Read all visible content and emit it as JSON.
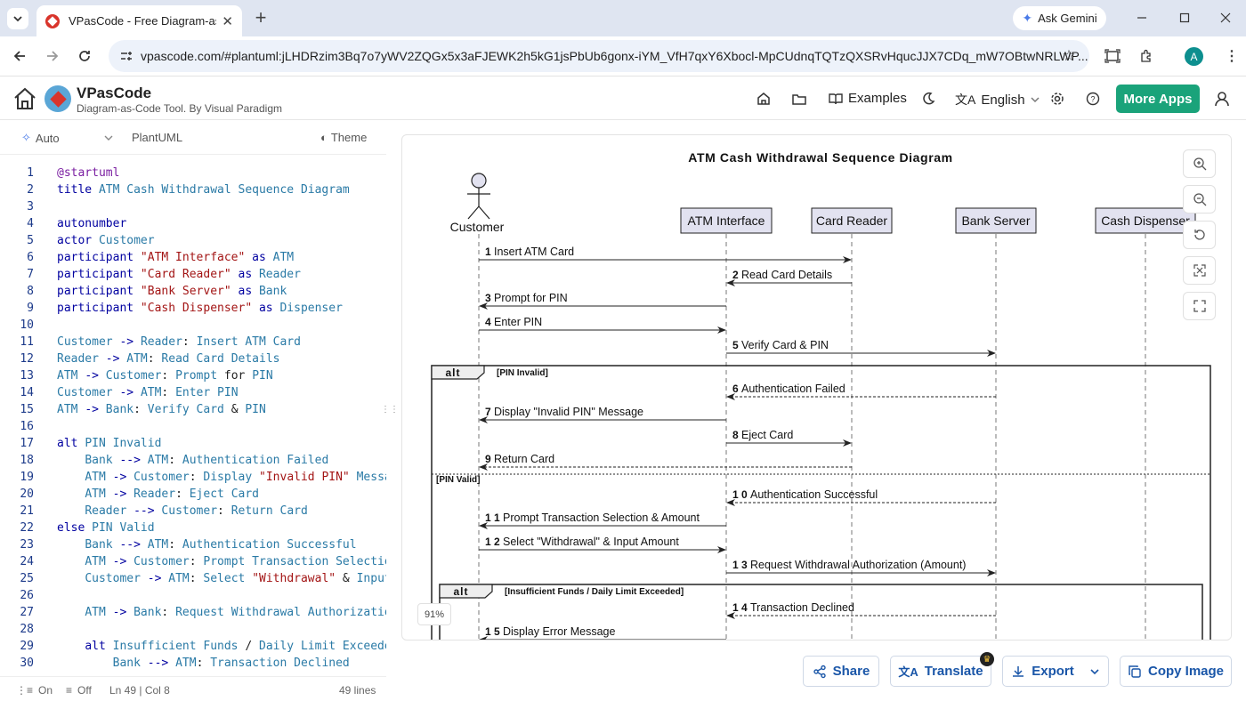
{
  "browser": {
    "tab_title": "VPasCode - Free Diagram-as-Co",
    "url": "vpascode.com/#plantuml:jLHDRzim3Bq7o7yWV2ZQGx5x3aFJEWK2h5kG1jsPbUb6gonx-iYM_VfH7qxY6Xbocl-MpCUdnqTQTzQXSRvHqucJJX7CDq_mW7OBtwNRLWP...",
    "ask_gemini": "Ask Gemini",
    "profile_initial": "A"
  },
  "app": {
    "name": "VPasCode",
    "subtitle": "Diagram-as-Code Tool. By Visual Paradigm",
    "nav": {
      "examples": "Examples",
      "language": "English",
      "more_apps": "More Apps"
    }
  },
  "editor_toolbar": {
    "mode": "Auto",
    "language": "PlantUML",
    "theme": "Theme"
  },
  "code_lines": [
    {
      "n": "1",
      "segs": [
        [
          "p",
          "@startuml"
        ]
      ]
    },
    {
      "n": "2",
      "segs": [
        [
          "k",
          "title "
        ],
        [
          "i",
          "ATM Cash Withdrawal Sequence Diagram"
        ]
      ]
    },
    {
      "n": "3",
      "segs": []
    },
    {
      "n": "4",
      "segs": [
        [
          "k",
          "autonumber"
        ]
      ]
    },
    {
      "n": "5",
      "segs": [
        [
          "k",
          "actor "
        ],
        [
          "i",
          "Customer"
        ]
      ]
    },
    {
      "n": "6",
      "segs": [
        [
          "k",
          "participant "
        ],
        [
          "s",
          "\"ATM Interface\""
        ],
        [
          "k",
          " as "
        ],
        [
          "i",
          "ATM"
        ]
      ]
    },
    {
      "n": "7",
      "segs": [
        [
          "k",
          "participant "
        ],
        [
          "s",
          "\"Card Reader\""
        ],
        [
          "k",
          " as "
        ],
        [
          "i",
          "Reader"
        ]
      ]
    },
    {
      "n": "8",
      "segs": [
        [
          "k",
          "participant "
        ],
        [
          "s",
          "\"Bank Server\""
        ],
        [
          "k",
          " as "
        ],
        [
          "i",
          "Bank"
        ]
      ]
    },
    {
      "n": "9",
      "segs": [
        [
          "k",
          "participant "
        ],
        [
          "s",
          "\"Cash Dispenser\""
        ],
        [
          "k",
          " as "
        ],
        [
          "i",
          "Dispenser"
        ]
      ]
    },
    {
      "n": "10",
      "segs": []
    },
    {
      "n": "11",
      "segs": [
        [
          "i",
          "Customer "
        ],
        [
          "k",
          "-> "
        ],
        [
          "i",
          "Reader"
        ],
        [
          "t",
          ": "
        ],
        [
          "i",
          "Insert ATM Card"
        ]
      ]
    },
    {
      "n": "12",
      "segs": [
        [
          "i",
          "Reader "
        ],
        [
          "k",
          "-> "
        ],
        [
          "i",
          "ATM"
        ],
        [
          "t",
          ": "
        ],
        [
          "i",
          "Read Card Details"
        ]
      ]
    },
    {
      "n": "13",
      "segs": [
        [
          "i",
          "ATM "
        ],
        [
          "k",
          "-> "
        ],
        [
          "i",
          "Customer"
        ],
        [
          "t",
          ": "
        ],
        [
          "i",
          "Prompt "
        ],
        [
          "t",
          "for "
        ],
        [
          "i",
          "PIN"
        ]
      ]
    },
    {
      "n": "14",
      "segs": [
        [
          "i",
          "Customer "
        ],
        [
          "k",
          "-> "
        ],
        [
          "i",
          "ATM"
        ],
        [
          "t",
          ": "
        ],
        [
          "i",
          "Enter PIN"
        ]
      ]
    },
    {
      "n": "15",
      "segs": [
        [
          "i",
          "ATM "
        ],
        [
          "k",
          "-> "
        ],
        [
          "i",
          "Bank"
        ],
        [
          "t",
          ": "
        ],
        [
          "i",
          "Verify Card "
        ],
        [
          "t",
          "& "
        ],
        [
          "i",
          "PIN"
        ]
      ]
    },
    {
      "n": "16",
      "segs": []
    },
    {
      "n": "17",
      "segs": [
        [
          "k",
          "alt "
        ],
        [
          "i",
          "PIN Invalid"
        ]
      ]
    },
    {
      "n": "18",
      "segs": [
        [
          "t",
          "    "
        ],
        [
          "i",
          "Bank "
        ],
        [
          "k",
          "--> "
        ],
        [
          "i",
          "ATM"
        ],
        [
          "t",
          ": "
        ],
        [
          "i",
          "Authentication Failed"
        ]
      ]
    },
    {
      "n": "19",
      "segs": [
        [
          "t",
          "    "
        ],
        [
          "i",
          "ATM "
        ],
        [
          "k",
          "-> "
        ],
        [
          "i",
          "Customer"
        ],
        [
          "t",
          ": "
        ],
        [
          "i",
          "Display "
        ],
        [
          "s",
          "\"Invalid PIN\""
        ],
        [
          "i",
          " Messa"
        ]
      ]
    },
    {
      "n": "20",
      "segs": [
        [
          "t",
          "    "
        ],
        [
          "i",
          "ATM "
        ],
        [
          "k",
          "-> "
        ],
        [
          "i",
          "Reader"
        ],
        [
          "t",
          ": "
        ],
        [
          "i",
          "Eject Card"
        ]
      ]
    },
    {
      "n": "21",
      "segs": [
        [
          "t",
          "    "
        ],
        [
          "i",
          "Reader "
        ],
        [
          "k",
          "--> "
        ],
        [
          "i",
          "Customer"
        ],
        [
          "t",
          ": "
        ],
        [
          "i",
          "Return Card"
        ]
      ]
    },
    {
      "n": "22",
      "segs": [
        [
          "k",
          "else "
        ],
        [
          "i",
          "PIN Valid"
        ]
      ]
    },
    {
      "n": "23",
      "segs": [
        [
          "t",
          "    "
        ],
        [
          "i",
          "Bank "
        ],
        [
          "k",
          "--> "
        ],
        [
          "i",
          "ATM"
        ],
        [
          "t",
          ": "
        ],
        [
          "i",
          "Authentication Successful"
        ]
      ]
    },
    {
      "n": "24",
      "segs": [
        [
          "t",
          "    "
        ],
        [
          "i",
          "ATM "
        ],
        [
          "k",
          "-> "
        ],
        [
          "i",
          "Customer"
        ],
        [
          "t",
          ": "
        ],
        [
          "i",
          "Prompt Transaction Selectio"
        ]
      ]
    },
    {
      "n": "25",
      "segs": [
        [
          "t",
          "    "
        ],
        [
          "i",
          "Customer "
        ],
        [
          "k",
          "-> "
        ],
        [
          "i",
          "ATM"
        ],
        [
          "t",
          ": "
        ],
        [
          "i",
          "Select "
        ],
        [
          "s",
          "\"Withdrawal\""
        ],
        [
          "t",
          " & "
        ],
        [
          "i",
          "Input"
        ]
      ]
    },
    {
      "n": "26",
      "segs": []
    },
    {
      "n": "27",
      "segs": [
        [
          "t",
          "    "
        ],
        [
          "i",
          "ATM "
        ],
        [
          "k",
          "-> "
        ],
        [
          "i",
          "Bank"
        ],
        [
          "t",
          ": "
        ],
        [
          "i",
          "Request Withdrawal Authorizatio"
        ]
      ]
    },
    {
      "n": "28",
      "segs": []
    },
    {
      "n": "29",
      "segs": [
        [
          "t",
          "    "
        ],
        [
          "k",
          "alt "
        ],
        [
          "i",
          "Insufficient Funds "
        ],
        [
          "t",
          "/ "
        ],
        [
          "i",
          "Daily Limit Exceede"
        ]
      ]
    },
    {
      "n": "30",
      "segs": [
        [
          "t",
          "        "
        ],
        [
          "i",
          "Bank "
        ],
        [
          "k",
          "--> "
        ],
        [
          "i",
          "ATM"
        ],
        [
          "t",
          ": "
        ],
        [
          "i",
          "Transaction Declined"
        ]
      ]
    }
  ],
  "editor_status": {
    "line_numbers": "On",
    "wrap": "Off",
    "cursor": "Ln 49 | Col 8",
    "total": "49 lines"
  },
  "diagram": {
    "title": "ATM Cash Withdrawal Sequence Diagram",
    "actor": "Customer",
    "participants": [
      "ATM Interface",
      "Card Reader",
      "Bank Server",
      "Cash Dispenser"
    ],
    "messages": [
      {
        "num": "1",
        "label": "Insert ATM Card",
        "from": "Customer",
        "to": "Card Reader",
        "dashed": false
      },
      {
        "num": "2",
        "label": "Read Card Details",
        "from": "Card Reader",
        "to": "ATM Interface",
        "dashed": false
      },
      {
        "num": "3",
        "label": "Prompt for PIN",
        "from": "ATM Interface",
        "to": "Customer",
        "dashed": false
      },
      {
        "num": "4",
        "label": "Enter PIN",
        "from": "Customer",
        "to": "ATM Interface",
        "dashed": false
      },
      {
        "num": "5",
        "label": "Verify Card & PIN",
        "from": "ATM Interface",
        "to": "Bank Server",
        "dashed": false
      },
      {
        "num": "6",
        "label": "Authentication Failed",
        "from": "Bank Server",
        "to": "ATM Interface",
        "dashed": true
      },
      {
        "num": "7",
        "label": "Display \"Invalid PIN\" Message",
        "from": "ATM Interface",
        "to": "Customer",
        "dashed": false
      },
      {
        "num": "8",
        "label": "Eject Card",
        "from": "ATM Interface",
        "to": "Card Reader",
        "dashed": false
      },
      {
        "num": "9",
        "label": "Return Card",
        "from": "Card Reader",
        "to": "Customer",
        "dashed": true
      },
      {
        "num": "1 0",
        "label": "Authentication Successful",
        "from": "Bank Server",
        "to": "ATM Interface",
        "dashed": true
      },
      {
        "num": "1 1",
        "label": "Prompt Transaction Selection & Amount",
        "from": "ATM Interface",
        "to": "Customer",
        "dashed": false
      },
      {
        "num": "1 2",
        "label": "Select \"Withdrawal\" & Input Amount",
        "from": "Customer",
        "to": "ATM Interface",
        "dashed": false
      },
      {
        "num": "1 3",
        "label": "Request Withdrawal Authorization (Amount)",
        "from": "ATM Interface",
        "to": "Bank Server",
        "dashed": false
      },
      {
        "num": "1 4",
        "label": "Transaction Declined",
        "from": "Bank Server",
        "to": "ATM Interface",
        "dashed": true
      },
      {
        "num": "1 5",
        "label": "Display Error Message",
        "from": "ATM Interface",
        "to": "Customer",
        "dashed": false
      }
    ],
    "fragments": [
      {
        "keyword": "alt",
        "guard": "[PIN Invalid]",
        "else_guard": "[PIN Valid]"
      },
      {
        "keyword": "alt",
        "guard": "[Insufficient Funds / Daily Limit Exceeded]"
      }
    ],
    "zoom": "91%"
  },
  "actions": {
    "share": "Share",
    "translate": "Translate",
    "export": "Export",
    "copy_image": "Copy Image"
  }
}
